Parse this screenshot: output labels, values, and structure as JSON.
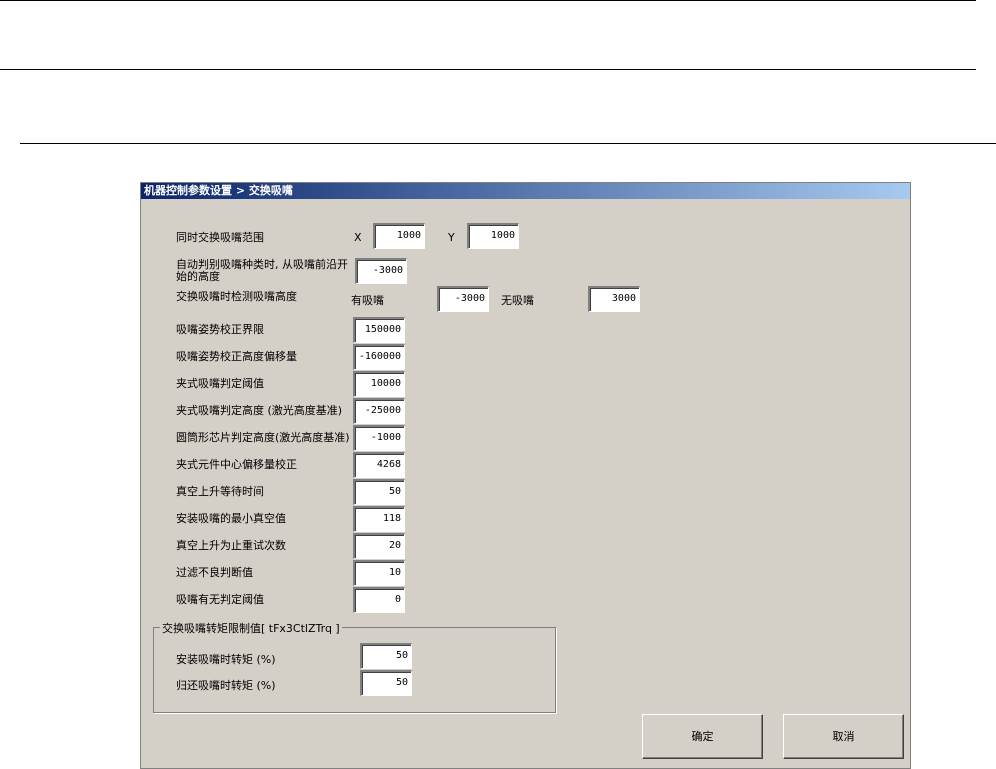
{
  "title": "机器控制参数设置 > 交换吸嘴",
  "row1": {
    "label": "同时交换吸嘴范围",
    "x_label": "X",
    "x_value": "1000",
    "y_label": "Y",
    "y_value": "1000"
  },
  "row2": {
    "label_line1": "自动判别吸嘴种类时, 从吸嘴前沿开",
    "label_line2": "始的高度",
    "value": "-3000"
  },
  "row3": {
    "label": "交换吸嘴时检测吸嘴高度",
    "with_label": "有吸嘴",
    "with_value": "-3000",
    "without_label": "无吸嘴",
    "without_value": "3000"
  },
  "params": [
    {
      "label": "吸嘴姿势校正界限",
      "value": "150000"
    },
    {
      "label": "吸嘴姿势校正高度偏移量",
      "value": "-160000"
    },
    {
      "label": "夹式吸嘴判定阈值",
      "value": "10000"
    },
    {
      "label": "夹式吸嘴判定高度 (激光高度基准)",
      "value": "-25000"
    },
    {
      "label": "圆筒形芯片判定高度(激光高度基准)",
      "value": "-1000"
    },
    {
      "label": "夹式元件中心偏移量校正",
      "value": "4268"
    },
    {
      "label": "真空上升等待时间",
      "value": "50"
    },
    {
      "label": "安装吸嘴的最小真空值",
      "value": "118"
    },
    {
      "label": "真空上升为止重试次数",
      "value": "20"
    },
    {
      "label": "过滤不良判断值",
      "value": "10"
    },
    {
      "label": "吸嘴有无判定阈值",
      "value": "0"
    }
  ],
  "group": {
    "title": "交换吸嘴转矩限制值[ tFx3CtlZTrq ]",
    "items": [
      {
        "label": "安装吸嘴时转矩 (%)",
        "value": "50"
      },
      {
        "label": "归还吸嘴时转矩 (%)",
        "value": "50"
      }
    ]
  },
  "buttons": {
    "ok": "确定",
    "cancel": "取消"
  }
}
